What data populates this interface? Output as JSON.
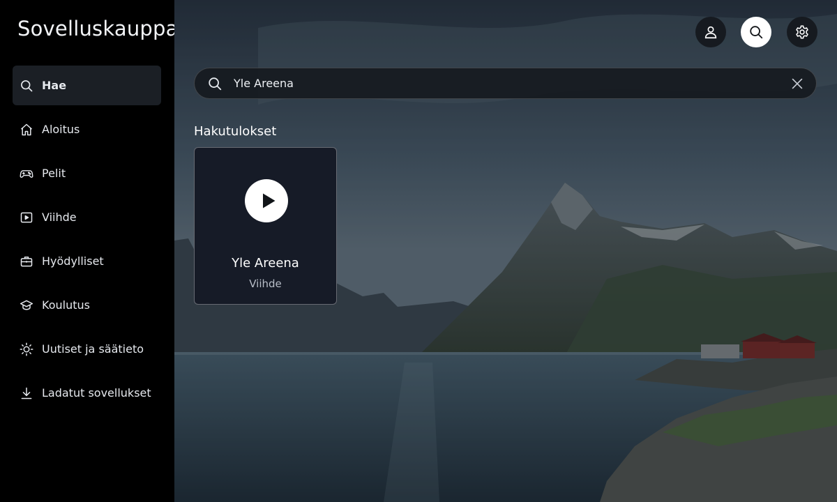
{
  "app": {
    "title": "Sovelluskauppa"
  },
  "sidebar": {
    "items": [
      {
        "label": "Hae",
        "icon": "search-icon",
        "active": true
      },
      {
        "label": "Aloitus",
        "icon": "home-icon"
      },
      {
        "label": "Pelit",
        "icon": "gamepad-icon"
      },
      {
        "label": "Viihde",
        "icon": "play-square-icon"
      },
      {
        "label": "Hyödylliset",
        "icon": "toolbox-icon"
      },
      {
        "label": "Koulutus",
        "icon": "graduation-cap-icon"
      },
      {
        "label": "Uutiset ja säätieto",
        "icon": "sun-icon"
      },
      {
        "label": "Ladatut sovellukset",
        "icon": "download-icon"
      }
    ]
  },
  "header": {
    "buttons": [
      {
        "icon": "profile-icon"
      },
      {
        "icon": "search-icon",
        "selected": true
      },
      {
        "icon": "gear-icon"
      }
    ]
  },
  "search": {
    "value": "Yle Areena",
    "clear_icon": "close-icon"
  },
  "results": {
    "title": "Hakutulokset",
    "items": [
      {
        "name": "Yle Areena",
        "category": "Viihde",
        "icon": "play-icon"
      }
    ]
  },
  "colors": {
    "sidebar_bg": "#000000",
    "active_item_bg": "#1b1f25",
    "card_bg": "#161b27",
    "accent_white": "#ffffff"
  }
}
